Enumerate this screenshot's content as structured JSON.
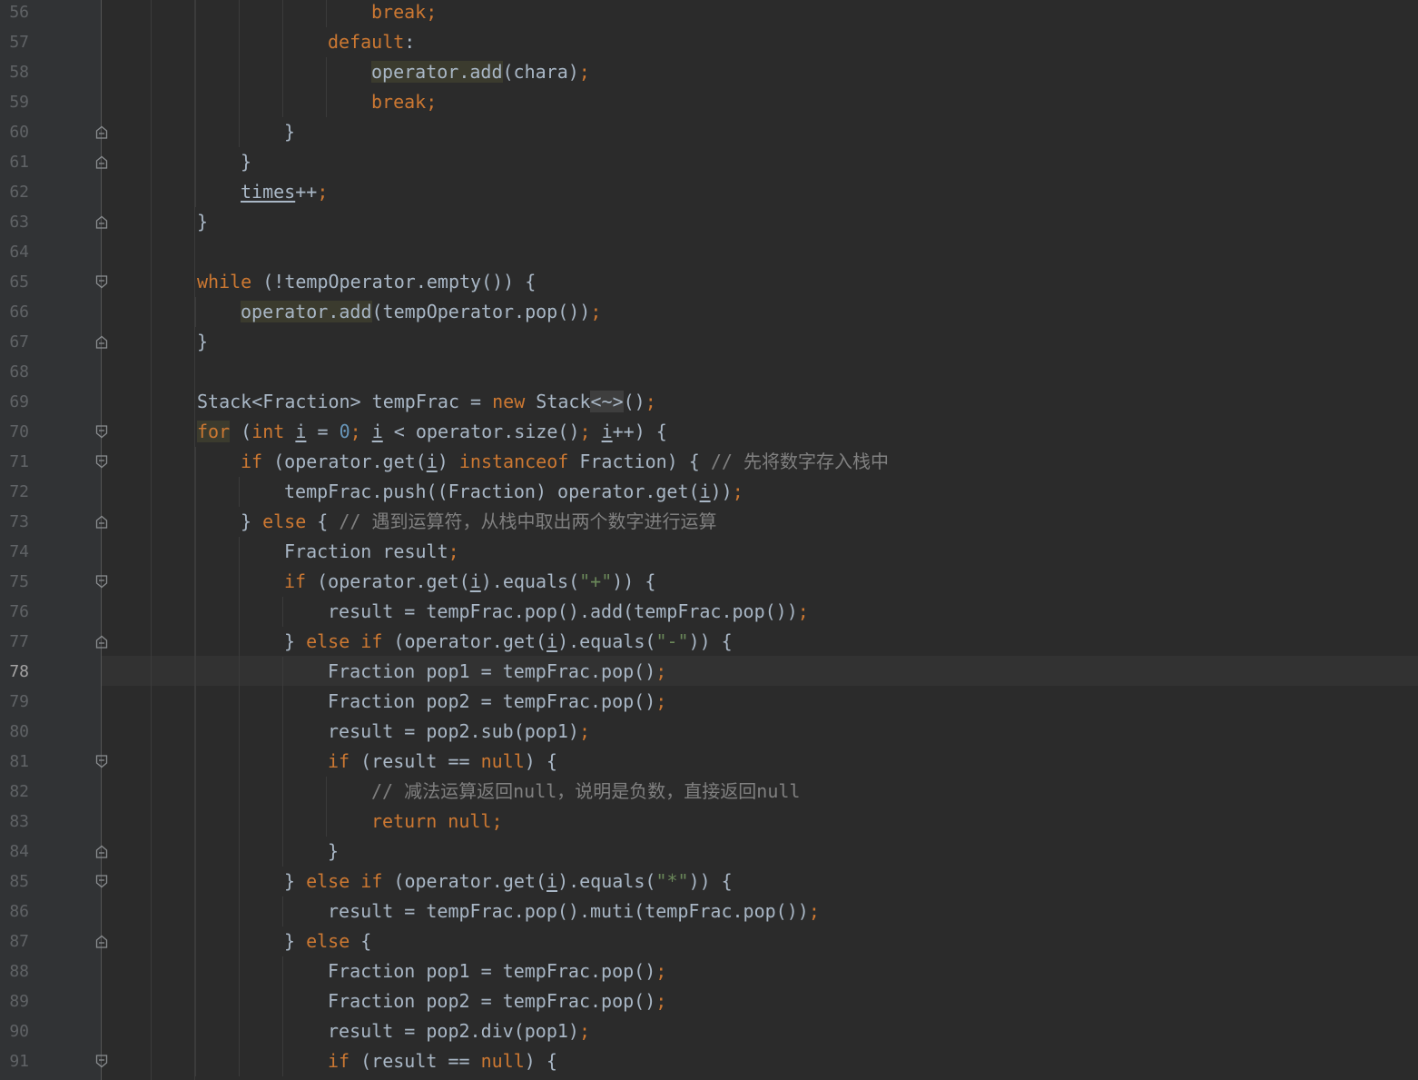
{
  "editor": {
    "colors": {
      "background": "#2b2b2b",
      "gutter": "#313335",
      "keyword": "#cc7832",
      "number": "#6897bb",
      "string": "#6a8759",
      "comment": "#808080",
      "text": "#a9b7c6",
      "line_number": "#606366",
      "current_line": "#323232"
    },
    "current_line": 78,
    "lines": [
      {
        "n": "56",
        "indent": 4,
        "fold": "",
        "tokens": [
          [
            "kw",
            "break"
          ],
          [
            "punct",
            ";"
          ]
        ]
      },
      {
        "n": "57",
        "indent": 3,
        "fold": "",
        "tokens": [
          [
            "kw",
            "default"
          ],
          [
            "plain",
            ":"
          ]
        ]
      },
      {
        "n": "58",
        "indent": 4,
        "fold": "",
        "tokens": [
          [
            "hl",
            "operator.add"
          ],
          [
            "plain",
            "(chara)"
          ],
          [
            "punct",
            ";"
          ]
        ]
      },
      {
        "n": "59",
        "indent": 4,
        "fold": "",
        "tokens": [
          [
            "kw",
            "break"
          ],
          [
            "punct",
            ";"
          ]
        ]
      },
      {
        "n": "60",
        "indent": 2,
        "fold": "end",
        "tokens": [
          [
            "plain",
            "}"
          ]
        ]
      },
      {
        "n": "61",
        "indent": 1,
        "fold": "end",
        "tokens": [
          [
            "plain",
            "}"
          ]
        ]
      },
      {
        "n": "62",
        "indent": 1,
        "fold": "",
        "tokens": [
          [
            "ul",
            "times"
          ],
          [
            "plain",
            "++"
          ],
          [
            "punct",
            ";"
          ]
        ]
      },
      {
        "n": "63",
        "indent": 0,
        "fold": "end",
        "tokens": [
          [
            "plain",
            "}"
          ]
        ]
      },
      {
        "n": "64",
        "indent": 0,
        "fold": "",
        "tokens": []
      },
      {
        "n": "65",
        "indent": 0,
        "fold": "start",
        "tokens": [
          [
            "kw",
            "while"
          ],
          [
            "plain",
            " (!tempOperator.empty()) {"
          ]
        ]
      },
      {
        "n": "66",
        "indent": 1,
        "fold": "",
        "tokens": [
          [
            "hl",
            "operator.add"
          ],
          [
            "plain",
            "(tempOperator.pop())"
          ],
          [
            "punct",
            ";"
          ]
        ]
      },
      {
        "n": "67",
        "indent": 0,
        "fold": "end",
        "tokens": [
          [
            "plain",
            "}"
          ]
        ]
      },
      {
        "n": "68",
        "indent": 0,
        "fold": "",
        "tokens": []
      },
      {
        "n": "69",
        "indent": 0,
        "fold": "",
        "tokens": [
          [
            "plain",
            "Stack<Fraction> tempFrac = "
          ],
          [
            "kw",
            "new"
          ],
          [
            "plain",
            " Stack"
          ],
          [
            "sel",
            "<~>"
          ],
          [
            "plain",
            "()"
          ],
          [
            "punct",
            ";"
          ]
        ]
      },
      {
        "n": "70",
        "indent": 0,
        "fold": "start",
        "tokens": [
          [
            "hlkw",
            "for"
          ],
          [
            "plain",
            " ("
          ],
          [
            "kw",
            "int"
          ],
          [
            "plain",
            " "
          ],
          [
            "ul",
            "i"
          ],
          [
            "plain",
            " = "
          ],
          [
            "num",
            "0"
          ],
          [
            "punct",
            ";"
          ],
          [
            "plain",
            " "
          ],
          [
            "ul",
            "i"
          ],
          [
            "plain",
            " < operator.size()"
          ],
          [
            "punct",
            ";"
          ],
          [
            "plain",
            " "
          ],
          [
            "ul",
            "i"
          ],
          [
            "plain",
            "++) {"
          ]
        ]
      },
      {
        "n": "71",
        "indent": 1,
        "fold": "start",
        "tokens": [
          [
            "kw",
            "if"
          ],
          [
            "plain",
            " (operator.get("
          ],
          [
            "ul",
            "i"
          ],
          [
            "plain",
            ") "
          ],
          [
            "kw",
            "instanceof"
          ],
          [
            "plain",
            " Fraction) { "
          ],
          [
            "cmt",
            "// "
          ],
          [
            "cmthan",
            "先将数字存入栈中"
          ]
        ]
      },
      {
        "n": "72",
        "indent": 2,
        "fold": "",
        "tokens": [
          [
            "plain",
            "tempFrac.push((Fraction) operator.get("
          ],
          [
            "ul",
            "i"
          ],
          [
            "plain",
            "))"
          ],
          [
            "punct",
            ";"
          ]
        ]
      },
      {
        "n": "73",
        "indent": 1,
        "fold": "end",
        "tokens": [
          [
            "plain",
            "} "
          ],
          [
            "kw",
            "else"
          ],
          [
            "plain",
            " { "
          ],
          [
            "cmt",
            "// "
          ],
          [
            "cmthan",
            "遇到运算符，从栈中取出两个数字进行运算"
          ]
        ]
      },
      {
        "n": "74",
        "indent": 2,
        "fold": "",
        "tokens": [
          [
            "plain",
            "Fraction result"
          ],
          [
            "punct",
            ";"
          ]
        ]
      },
      {
        "n": "75",
        "indent": 2,
        "fold": "start",
        "tokens": [
          [
            "kw",
            "if"
          ],
          [
            "plain",
            " (operator.get("
          ],
          [
            "ul",
            "i"
          ],
          [
            "plain",
            ").equals("
          ],
          [
            "str",
            "\"+\""
          ],
          [
            "plain",
            ")) {"
          ]
        ]
      },
      {
        "n": "76",
        "indent": 3,
        "fold": "",
        "tokens": [
          [
            "plain",
            "result = tempFrac.pop().add(tempFrac.pop())"
          ],
          [
            "punct",
            ";"
          ]
        ]
      },
      {
        "n": "77",
        "indent": 2,
        "fold": "end",
        "tokens": [
          [
            "plain",
            "} "
          ],
          [
            "kw",
            "else if"
          ],
          [
            "plain",
            " (operator.get("
          ],
          [
            "ul",
            "i"
          ],
          [
            "plain",
            ").equals("
          ],
          [
            "str",
            "\"-\""
          ],
          [
            "plain",
            ")) {"
          ]
        ]
      },
      {
        "n": "78",
        "indent": 3,
        "fold": "",
        "tokens": [
          [
            "plain",
            "Fraction pop1 = tempFrac.pop()"
          ],
          [
            "punct",
            ";"
          ]
        ]
      },
      {
        "n": "79",
        "indent": 3,
        "fold": "",
        "tokens": [
          [
            "plain",
            "Fraction pop2 = tempFrac.pop()"
          ],
          [
            "punct",
            ";"
          ]
        ]
      },
      {
        "n": "80",
        "indent": 3,
        "fold": "",
        "tokens": [
          [
            "plain",
            "result = pop2.sub(pop1)"
          ],
          [
            "punct",
            ";"
          ]
        ]
      },
      {
        "n": "81",
        "indent": 3,
        "fold": "start",
        "tokens": [
          [
            "kw",
            "if"
          ],
          [
            "plain",
            " (result == "
          ],
          [
            "kw",
            "null"
          ],
          [
            "plain",
            ") {"
          ]
        ]
      },
      {
        "n": "82",
        "indent": 4,
        "fold": "",
        "tokens": [
          [
            "cmt",
            "// "
          ],
          [
            "cmthan",
            "减法运算返回"
          ],
          [
            "cmt",
            "null"
          ],
          [
            "cmthan",
            "，说明是负数，直接返回"
          ],
          [
            "cmt",
            "null"
          ]
        ]
      },
      {
        "n": "83",
        "indent": 4,
        "fold": "",
        "tokens": [
          [
            "kw",
            "return null"
          ],
          [
            "punct",
            ";"
          ]
        ]
      },
      {
        "n": "84",
        "indent": 3,
        "fold": "end",
        "tokens": [
          [
            "plain",
            "}"
          ]
        ]
      },
      {
        "n": "85",
        "indent": 2,
        "fold": "start",
        "tokens": [
          [
            "plain",
            "} "
          ],
          [
            "kw",
            "else if"
          ],
          [
            "plain",
            " (operator.get("
          ],
          [
            "ul",
            "i"
          ],
          [
            "plain",
            ").equals("
          ],
          [
            "str",
            "\"*\""
          ],
          [
            "plain",
            ")) {"
          ]
        ]
      },
      {
        "n": "86",
        "indent": 3,
        "fold": "",
        "tokens": [
          [
            "plain",
            "result = tempFrac.pop().muti(tempFrac.pop())"
          ],
          [
            "punct",
            ";"
          ]
        ]
      },
      {
        "n": "87",
        "indent": 2,
        "fold": "end",
        "tokens": [
          [
            "plain",
            "} "
          ],
          [
            "kw",
            "else"
          ],
          [
            "plain",
            " {"
          ]
        ]
      },
      {
        "n": "88",
        "indent": 3,
        "fold": "",
        "tokens": [
          [
            "plain",
            "Fraction pop1 = tempFrac.pop()"
          ],
          [
            "punct",
            ";"
          ]
        ]
      },
      {
        "n": "89",
        "indent": 3,
        "fold": "",
        "tokens": [
          [
            "plain",
            "Fraction pop2 = tempFrac.pop()"
          ],
          [
            "punct",
            ";"
          ]
        ]
      },
      {
        "n": "90",
        "indent": 3,
        "fold": "",
        "tokens": [
          [
            "plain",
            "result = pop2.div(pop1)"
          ],
          [
            "punct",
            ";"
          ]
        ]
      },
      {
        "n": "91",
        "indent": 3,
        "fold": "start",
        "tokens": [
          [
            "kw",
            "if"
          ],
          [
            "plain",
            " (result == "
          ],
          [
            "kw",
            "null"
          ],
          [
            "plain",
            ") {"
          ]
        ]
      }
    ]
  }
}
